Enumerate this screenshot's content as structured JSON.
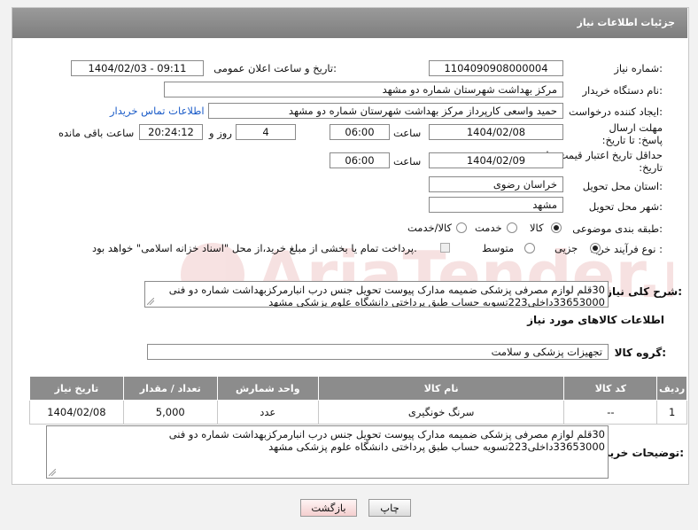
{
  "header": {
    "title": "جزئیات اطلاعات نیاز"
  },
  "fields": {
    "need_number_label": "شماره نیاز:",
    "need_number": "1104090908000004",
    "announce_label": "تاریخ و ساعت اعلان عمومی:",
    "announce_value": "1404/02/03 - 09:11",
    "buyer_org_label": "نام دستگاه خریدار:",
    "buyer_org": "مرکز بهداشت شهرستان شماره دو مشهد",
    "creator_label": "ایجاد کننده درخواست:",
    "creator": "حمید واسعی کارپرداز مرکز بهداشت شهرستان شماره دو مشهد",
    "contact_link": "اطلاعات تماس خریدار",
    "deadline_label": "مهلت ارسال پاسخ: تا تاریخ:",
    "deadline_date": "1404/02/08",
    "time_label": "ساعت",
    "deadline_time": "06:00",
    "days": "4",
    "days_label": "روز و",
    "remaining_time": "20:24:12",
    "remaining_label": "ساعت باقی مانده",
    "validity_label": "حداقل تاریخ اعتبار قیمت: تا تاریخ:",
    "validity_date": "1404/02/09",
    "validity_time": "06:00",
    "province_label": "استان محل تحویل:",
    "province": "خراسان رضوی",
    "city_label": "شهر محل تحویل:",
    "city": "مشهد",
    "category_label": "طبقه بندی موضوعی:",
    "category_options": [
      "کالا",
      "خدمت",
      "کالا/خدمت"
    ],
    "process_label": "نوع فرآیند خرید :",
    "process_options": [
      "جزیی",
      "متوسط"
    ],
    "payment_note": "پرداخت تمام یا بخشی از مبلغ خرید،از محل \"اسناد خزانه اسلامی\" خواهد بود."
  },
  "summary": {
    "label": "شرح کلی نیاز:",
    "text": "30قلم لوازم مصرفی پزشکی ضمیمه مدارک پیوست تحویل جنس درب انبارمرکزبهداشت شماره دو فنی 33653000داخلی223تسویه حساب طبق پرداختی دانشگاه علوم پزشکی مشهد"
  },
  "goods_section": {
    "title": "اطلاعات کالاهای مورد نیاز",
    "group_label": "گروه کالا:",
    "group_value": "تجهیزات پزشکی و سلامت"
  },
  "table": {
    "headers": [
      "ردیف",
      "کد کالا",
      "نام کالا",
      "واحد شمارش",
      "تعداد / مقدار",
      "تاریخ نیاز"
    ],
    "rows": [
      {
        "index": "1",
        "code": "--",
        "name": "سرنگ خونگیری",
        "unit": "عدد",
        "qty": "5,000",
        "date": "1404/02/08"
      }
    ]
  },
  "buyer_notes": {
    "label": "توضیحات خریدار:",
    "text": "30قلم لوازم مصرفی پزشکی ضمیمه مدارک پیوست تحویل جنس درب انبارمرکزبهداشت شماره دو فنی 33653000داخلی223تسویه حساب طبق پرداختی دانشگاه علوم پزشکی مشهد"
  },
  "buttons": {
    "print": "چاپ",
    "back": "بازگشت"
  },
  "colors": {
    "header_bg": "#8c8c8c",
    "link": "#1a5bc8",
    "back_button": "#f4cfcf"
  }
}
